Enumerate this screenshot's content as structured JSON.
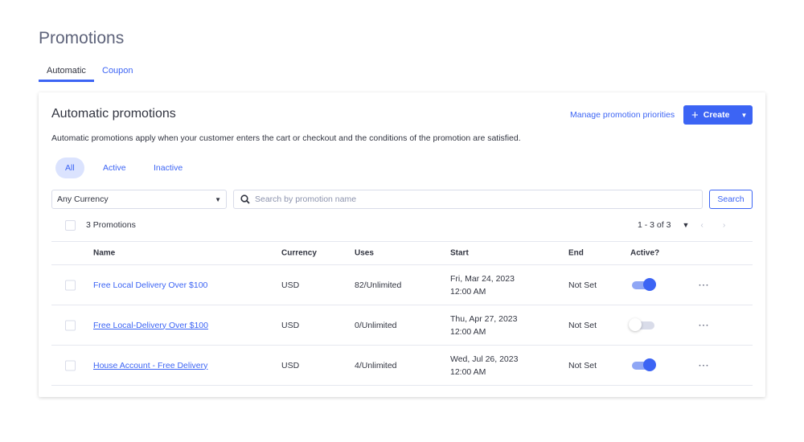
{
  "page": {
    "title": "Promotions",
    "tabs": [
      {
        "label": "Automatic"
      },
      {
        "label": "Coupon"
      }
    ]
  },
  "card": {
    "title": "Automatic promotions",
    "description": "Automatic promotions apply when your customer enters the cart or checkout and the conditions of the promotion are satisfied.",
    "manage_link": "Manage promotion priorities",
    "create_label": "Create"
  },
  "filters": [
    {
      "label": "All"
    },
    {
      "label": "Active"
    },
    {
      "label": "Inactive"
    }
  ],
  "currency_select": {
    "value": "Any Currency"
  },
  "search": {
    "placeholder": "Search by promotion name",
    "button": "Search"
  },
  "summary": {
    "count": "3 Promotions",
    "pagination": "1 - 3 of 3"
  },
  "columns": {
    "name": "Name",
    "currency": "Currency",
    "uses": "Uses",
    "start": "Start",
    "end": "End",
    "active": "Active?"
  },
  "rows": [
    {
      "name": "Free Local Delivery Over $100",
      "currency": "USD",
      "uses": "82/Unlimited",
      "start_date": "Fri, Mar 24, 2023",
      "start_time": "12:00 AM",
      "end": "Not Set",
      "active": true
    },
    {
      "name": "Free Local-Delivery Over $100",
      "currency": "USD",
      "uses": "0/Unlimited",
      "start_date": "Thu, Apr 27, 2023",
      "start_time": "12:00 AM",
      "end": "Not Set",
      "active": false
    },
    {
      "name": "House Account - Free Delivery",
      "currency": "USD",
      "uses": "4/Unlimited",
      "start_date": "Wed, Jul 26, 2023",
      "start_time": "12:00 AM",
      "end": "Not Set",
      "active": true
    }
  ],
  "colors": {
    "accent": "#3c64f4"
  }
}
